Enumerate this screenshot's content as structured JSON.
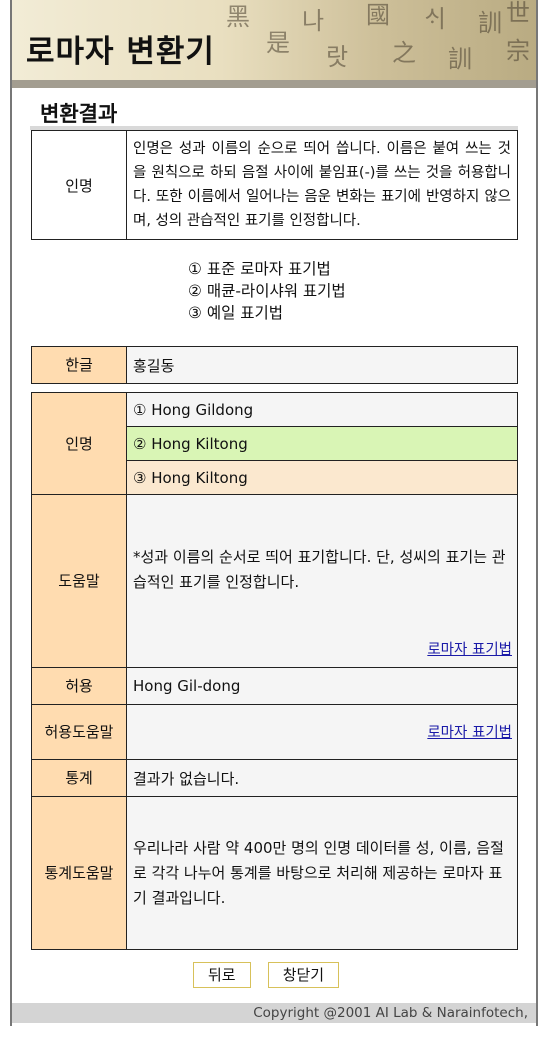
{
  "banner": {
    "title": "로마자 변환기"
  },
  "section": {
    "title": "변환결과"
  },
  "note": {
    "label": "인명",
    "text": "인명은 성과 이름의 순으로 띄어 씁니다. 이름은 붙여 쓰는 것을 원칙으로 하되 음절 사이에 붙임표(-)를 쓰는 것을 허용합니다. 또한 이름에서 일어나는 음운 변화는 표기에 반영하지 않으며, 성의 관습적인 표기를 인정합니다."
  },
  "options": [
    "① 표준 로마자 표기법",
    "② 매큔-라이샤워 표기법",
    "③ 예일 표기법"
  ],
  "result": {
    "hangul_label": "한글",
    "hangul_value": "홍길동",
    "name_label": "인명",
    "names": [
      "① Hong Gildong",
      "② Hong Kiltong",
      "③ Hong Kiltong"
    ],
    "help_label": "도움말",
    "help_text": "*성과 이름의 순서로 띄어 표기합니다. 단, 성씨의 표기는 관습적인 표기를 인정합니다.",
    "help_link": "로마자 표기법",
    "allow_label": "허용",
    "allow_value": "Hong Gil-dong",
    "allow_help_label": "허용도움말",
    "allow_help_link": "로마자 표기법",
    "stats_label": "통계",
    "stats_value": "결과가 없습니다.",
    "stats_help_label": "통계도움말",
    "stats_help_text": "우리나라 사람 약 400만 명의 인명 데이터를 성, 이름, 음절로 각각 나누어 통계를 바탕으로 처리해 제공하는 로마자 표기 결과입니다."
  },
  "buttons": {
    "back": "뒤로",
    "close": "창닫기"
  },
  "footer": {
    "copyright": "Copyright @2001 AI Lab & Narainfotech,"
  },
  "colors": {
    "label_bg": "#ffdcb0",
    "highlight_row": "#d9f5b5",
    "alt_row": "#fbe8cf",
    "button_border": "#d7c15a"
  }
}
